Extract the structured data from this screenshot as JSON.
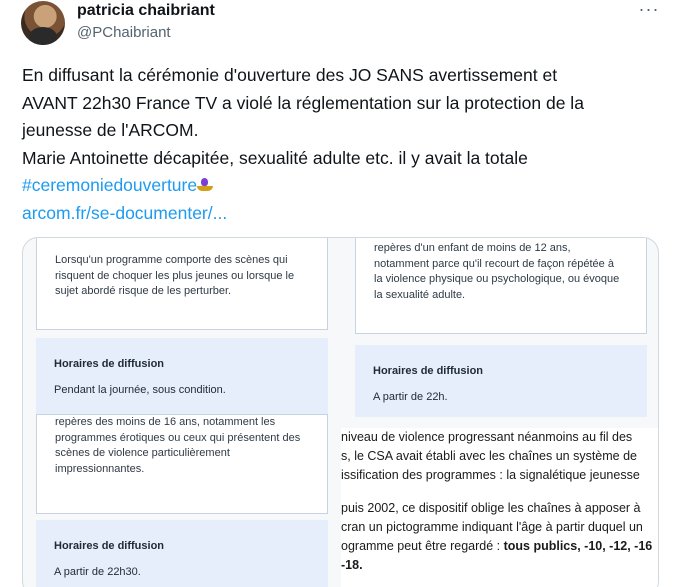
{
  "tweet": {
    "author_name": "patricia chaibriant",
    "author_handle": "@PChaibriant",
    "more_icon": "···",
    "text_lines": [
      "En diffusant la cérémonie d'ouverture des JO SANS avertissement et",
      "AVANT 22h30 France TV a violé la réglementation sur la protection de la",
      "jeunesse de l'ARCOM.",
      "Marie Antoinette décapitée, sexualité adulte etc. il y avait la totale"
    ],
    "hashtag": "#ceremoniedouverture",
    "link": "arcom.fr/se-documenter/..."
  },
  "image": {
    "card_top_left": [
      "Lorsqu'un programme comporte des scènes qui",
      "risquent de choquer les plus jeunes ou lorsque le",
      "sujet abordé risque de les perturber."
    ],
    "sched1": {
      "title": "Horaires de diffusion",
      "value": "Pendant la journée, sous condition."
    },
    "card_top_right": [
      "repères d'un enfant de moins de 12 ans,",
      "notamment parce qu'il recourt de façon répétée à",
      "la violence physique ou psychologique, ou évoque",
      "la sexualité adulte."
    ],
    "sched2": {
      "title": "Horaires de diffusion",
      "value": "A partir de 22h."
    },
    "card_mid_left": [
      "repères des moins de 16 ans, notamment les",
      "programmes érotiques ou ceux qui présentent des",
      "scènes de violence particulièrement",
      "impressionnantes."
    ],
    "sched3": {
      "title": "Horaires de diffusion",
      "value": "A partir de 22h30."
    },
    "article_lines": [
      "niveau de violence progressant néanmoins au fil des",
      "s, le CSA avait établi avec les chaînes un système de",
      "issification des programmes : la signalétique jeunesse",
      "puis 2002, ce dispositif oblige les chaînes à apposer à",
      "cran un pictogramme indiquant l'âge à partir duquel un",
      "ogramme peut être regardé : "
    ],
    "article_bold": "tous publics, -10, -12, -16",
    "article_last": "-18."
  }
}
